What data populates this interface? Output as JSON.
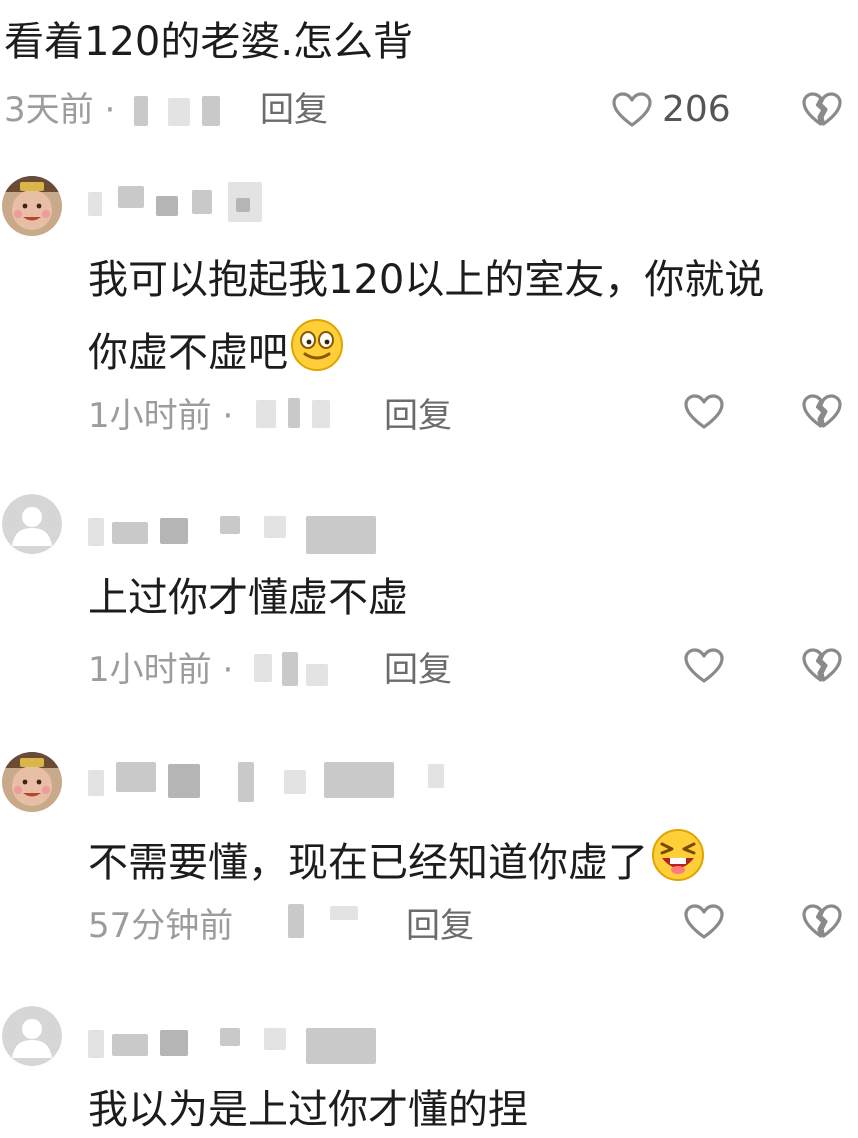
{
  "top_comment": {
    "text": "看着120的老婆.怎么背",
    "time": "3天前 ·",
    "reply_label": "回复",
    "like_count": "206"
  },
  "replies": [
    {
      "avatar": "photo",
      "line1": "我可以抱起我120以上的室友，你就说",
      "line2": "你虚不虚吧",
      "emoji": "smirk-face-emoji",
      "time": "1小时前 ·",
      "reply_label": "回复"
    },
    {
      "avatar": "default",
      "line1": "上过你才懂虚不虚",
      "time": "1小时前 ·",
      "reply_label": "回复"
    },
    {
      "avatar": "photo",
      "line1": "不需要懂，现在已经知道你虚了",
      "emoji": "laughing-face-emoji",
      "time": "57分钟前",
      "reply_label": "回复"
    },
    {
      "avatar": "default",
      "line1": "我以为是上过你才懂的捏"
    }
  ],
  "icons": {
    "like": "heart-outline-icon",
    "dislike": "broken-heart-icon"
  },
  "colors": {
    "text": "#1c1c1c",
    "meta": "#9c9c9c",
    "icon": "#8a8a8a"
  }
}
